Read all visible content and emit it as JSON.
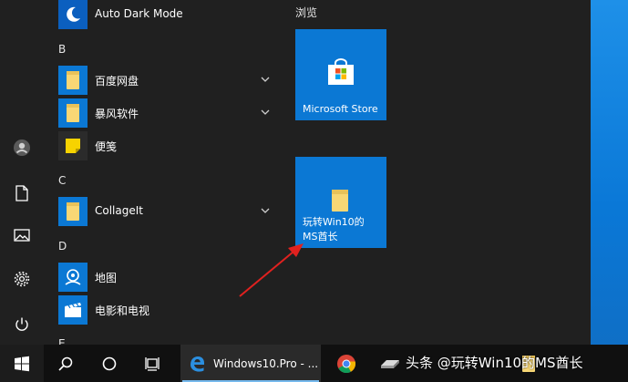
{
  "app_list": {
    "items": [
      {
        "kind": "app",
        "label": "Auto Dark Mode",
        "icon": "moon-icon",
        "expandable": false
      },
      {
        "kind": "letter",
        "label": "B"
      },
      {
        "kind": "app",
        "label": "百度网盘",
        "icon": "folder-icon",
        "expandable": true
      },
      {
        "kind": "app",
        "label": "暴风软件",
        "icon": "folder-icon",
        "expandable": true
      },
      {
        "kind": "app",
        "label": "便笺",
        "icon": "sticky-note-icon",
        "expandable": false
      },
      {
        "kind": "letter",
        "label": "C"
      },
      {
        "kind": "app",
        "label": "CollageIt",
        "icon": "folder-icon",
        "expandable": true
      },
      {
        "kind": "letter",
        "label": "D"
      },
      {
        "kind": "app",
        "label": "地图",
        "icon": "maps-icon",
        "expandable": false
      },
      {
        "kind": "app",
        "label": "电影和电视",
        "icon": "movies-tv-icon",
        "expandable": false
      },
      {
        "kind": "letter",
        "label": "E"
      }
    ]
  },
  "tiles": {
    "group_title": "浏览",
    "store": {
      "label": "Microsoft Store",
      "icon": "store-bag-icon"
    },
    "folder": {
      "label_line1": "玩转Win10的",
      "label_line2": "MS酋长",
      "icon": "folder-icon"
    }
  },
  "taskbar": {
    "window1_label": "Windows10.Pro - ...",
    "watermark": "头条 @玩转Win10的MS酋长"
  },
  "colors": {
    "tile_blue": "#0b78d4",
    "menu_bg": "#202020",
    "taskbar_bg": "#101010",
    "arrow_red": "#e0211f",
    "folder_yellow": "#f8d775"
  }
}
